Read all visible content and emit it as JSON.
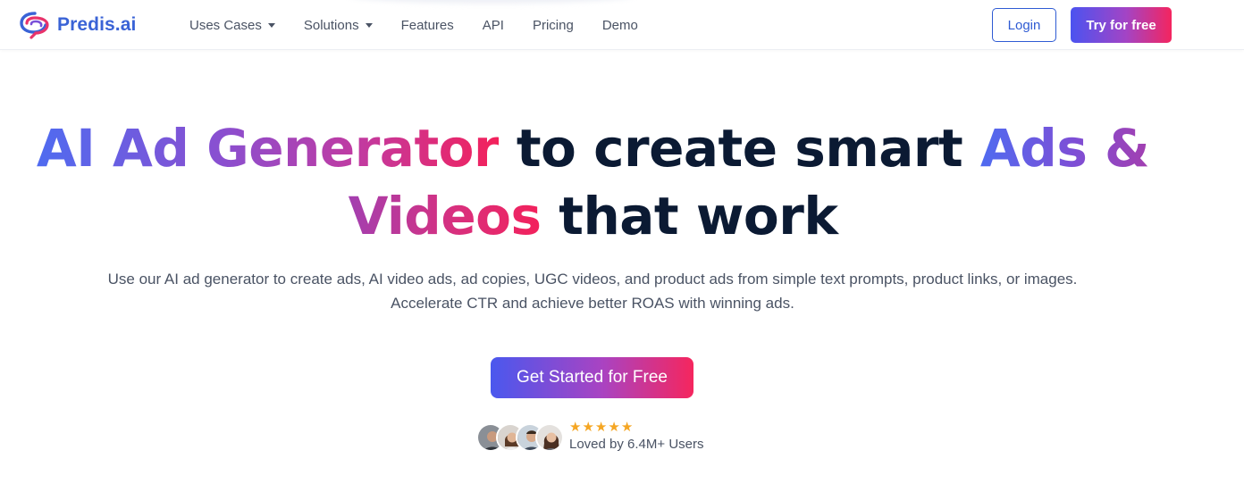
{
  "header": {
    "logo_text": "Predis.ai",
    "nav": [
      {
        "label": "Uses Cases",
        "dropdown": true
      },
      {
        "label": "Solutions",
        "dropdown": true
      },
      {
        "label": "Features",
        "dropdown": false
      },
      {
        "label": "API",
        "dropdown": false
      },
      {
        "label": "Pricing",
        "dropdown": false
      },
      {
        "label": "Demo",
        "dropdown": false
      }
    ],
    "login_label": "Login",
    "try_label": "Try for free"
  },
  "hero": {
    "title_part1": "AI Ad Generator",
    "title_part2": " to create smart ",
    "title_part3": "Ads &",
    "title_part4": "Videos",
    "title_part5": " that work",
    "subtitle_line1": "Use our AI ad generator to create ads, AI video ads, ad copies, UGC videos, and product ads from simple text prompts, product links, or images.",
    "subtitle_line2": "Accelerate CTR and achieve better ROAS with winning ads.",
    "cta_label": "Get Started for Free",
    "rating_stars": 5,
    "star_glyph": "★",
    "social_proof": "Loved by 6.4M+ Users"
  },
  "colors": {
    "brand_blue": "#3a63d6",
    "gradient_start": "#4b53f0",
    "gradient_mid": "#a344c5",
    "gradient_end": "#f4255f",
    "star": "#f5a623",
    "heading": "#0b1a33",
    "body_text": "#4a5364"
  }
}
